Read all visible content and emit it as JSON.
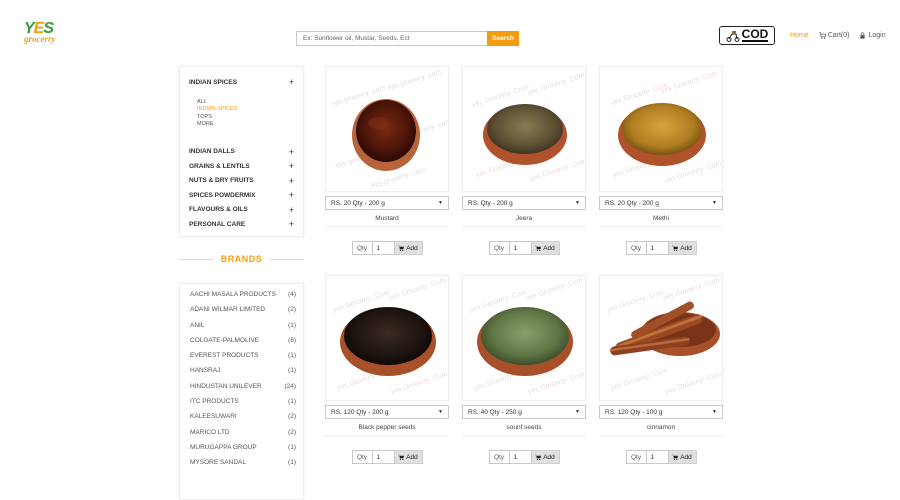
{
  "header": {
    "logo_text_top": "YES",
    "logo_text_bottom": "grocerry",
    "search_placeholder": "Ex: Sunflower oil, Mustar, Seeds, Ect",
    "search_button": "Search",
    "cod_badge": "COD",
    "nav": {
      "home": "Home",
      "cart": "Cart(0)",
      "login": "Login"
    }
  },
  "categories": [
    {
      "label": "INDIAN SPICES",
      "expanded": true
    },
    {
      "label": "INDIAN DALLS"
    },
    {
      "label": "GRAINS & LENTILS"
    },
    {
      "label": "NUTS & DRY FRUITS"
    },
    {
      "label": "SPICES POWDERMIX"
    },
    {
      "label": "FLAVOURS & OILS"
    },
    {
      "label": "PERSONAL CARE"
    }
  ],
  "subcategories": [
    "ALL",
    "INDIAN SPICES",
    "TOPS",
    "MORE"
  ],
  "plus_symbol": "+",
  "brands_title": "BRANDS",
  "brands": [
    {
      "name": "AACHI MASALA PRODUCTS",
      "count": "(4)"
    },
    {
      "name": "ADANI WILMAR LIMITED",
      "count": "(2)"
    },
    {
      "name": "ANIL",
      "count": "(1)"
    },
    {
      "name": "COLGATE-PALMOLIVE",
      "count": "(8)"
    },
    {
      "name": "EVEREST PRODUCTS",
      "count": "(1)"
    },
    {
      "name": "HANSRAJ",
      "count": "(1)"
    },
    {
      "name": "HINDUSTAN UNILEVER",
      "count": "(24)"
    },
    {
      "name": "ITC PRODUCTS",
      "count": "(1)"
    },
    {
      "name": "KALEESUWARI",
      "count": "(2)"
    },
    {
      "name": "MARICO LTD",
      "count": "(2)"
    },
    {
      "name": "MURUGAPPA GROUP",
      "count": "(1)"
    },
    {
      "name": "MYSORE SANDAL",
      "count": "(1)"
    }
  ],
  "products": [
    {
      "name": "Mustard",
      "price": "RS. 20 Qty - 200 g",
      "qty": "1",
      "watermark": "Yes grocerry .com"
    },
    {
      "name": "Jeera",
      "price": "RS. Qty - 200 g",
      "qty": "1",
      "watermark": "yes Grocerry .Com"
    },
    {
      "name": "Methi",
      "price": "RS. 20 Qty - 200 g",
      "qty": "1",
      "watermark": "yes Grocerry .Com"
    },
    {
      "name": "Black pepper seeds",
      "price": "RS. 120 Qty - 200 g",
      "qty": "1",
      "watermark": "yes Grocerry .Com"
    },
    {
      "name": "sounf seeds",
      "price": "RS. 40 Qty - 250 g",
      "qty": "1",
      "watermark": "yes Grocerry .Com"
    },
    {
      "name": "cinnamon",
      "price": "RS. 120 Qty - 100 g",
      "qty": "1",
      "watermark": "yes Grocerry .Com"
    }
  ],
  "qty_label": "Qty",
  "add_label": "Add",
  "colors": {
    "accent": "#f39c12",
    "logo_green": "#2e9e2e"
  }
}
